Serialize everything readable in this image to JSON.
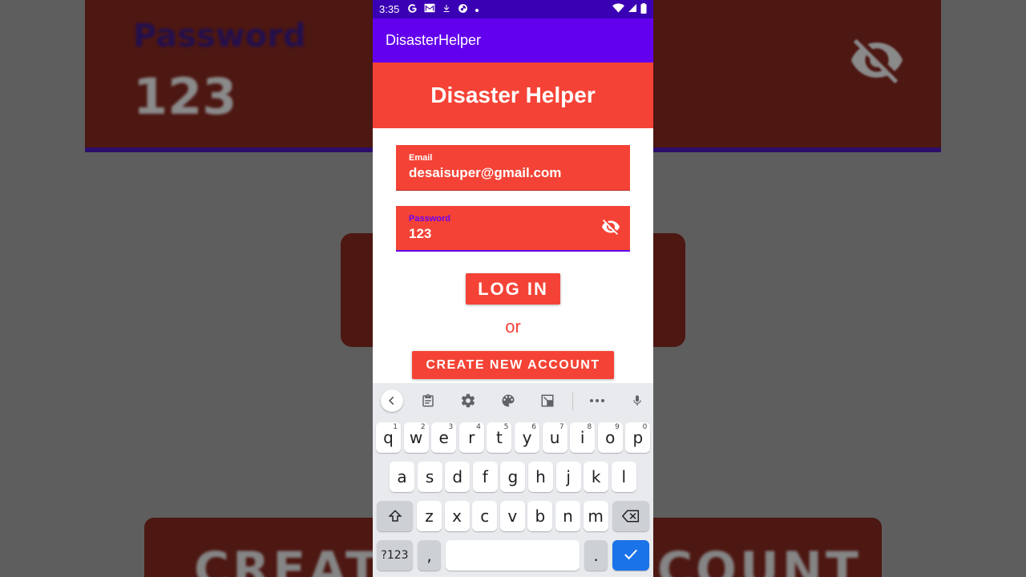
{
  "background": {
    "password_label": "Password",
    "password_value": "123",
    "create_left": "CREAT",
    "create_right": "COUNT"
  },
  "statusbar": {
    "time": "3:35",
    "notification_icons": [
      "google-icon",
      "gmail-icon",
      "download-icon",
      "app-icon",
      "dot-icon"
    ],
    "right_icons": [
      "wifi-icon",
      "signal-icon",
      "battery-icon"
    ]
  },
  "appbar": {
    "title": "DisasterHelper"
  },
  "header": {
    "title": "Disaster Helper"
  },
  "form": {
    "email_label": "Email",
    "email_value": "desaisuper@gmail.com",
    "password_label": "Password",
    "password_value": "123",
    "login_label": "LOG IN",
    "or_text": "or",
    "create_label": "CREATE NEW ACCOUNT"
  },
  "keyboard": {
    "toolbar": [
      "back-icon",
      "clipboard-icon",
      "settings-icon",
      "palette-icon",
      "floating-keyboard-icon",
      "more-icon",
      "mic-icon"
    ],
    "row1": [
      {
        "k": "q",
        "s": "1"
      },
      {
        "k": "w",
        "s": "2"
      },
      {
        "k": "e",
        "s": "3"
      },
      {
        "k": "r",
        "s": "4"
      },
      {
        "k": "t",
        "s": "5"
      },
      {
        "k": "y",
        "s": "6"
      },
      {
        "k": "u",
        "s": "7"
      },
      {
        "k": "i",
        "s": "8"
      },
      {
        "k": "o",
        "s": "9"
      },
      {
        "k": "p",
        "s": "0"
      }
    ],
    "row2": [
      "a",
      "s",
      "d",
      "f",
      "g",
      "h",
      "j",
      "k",
      "l"
    ],
    "row3": [
      "z",
      "x",
      "c",
      "v",
      "b",
      "n",
      "m"
    ],
    "symbols_label": "?123",
    "comma": ",",
    "period": "."
  },
  "colors": {
    "primary": "#6200ee",
    "status": "#3a00b3",
    "accent": "#f44336",
    "key_blue": "#1a73e8"
  }
}
